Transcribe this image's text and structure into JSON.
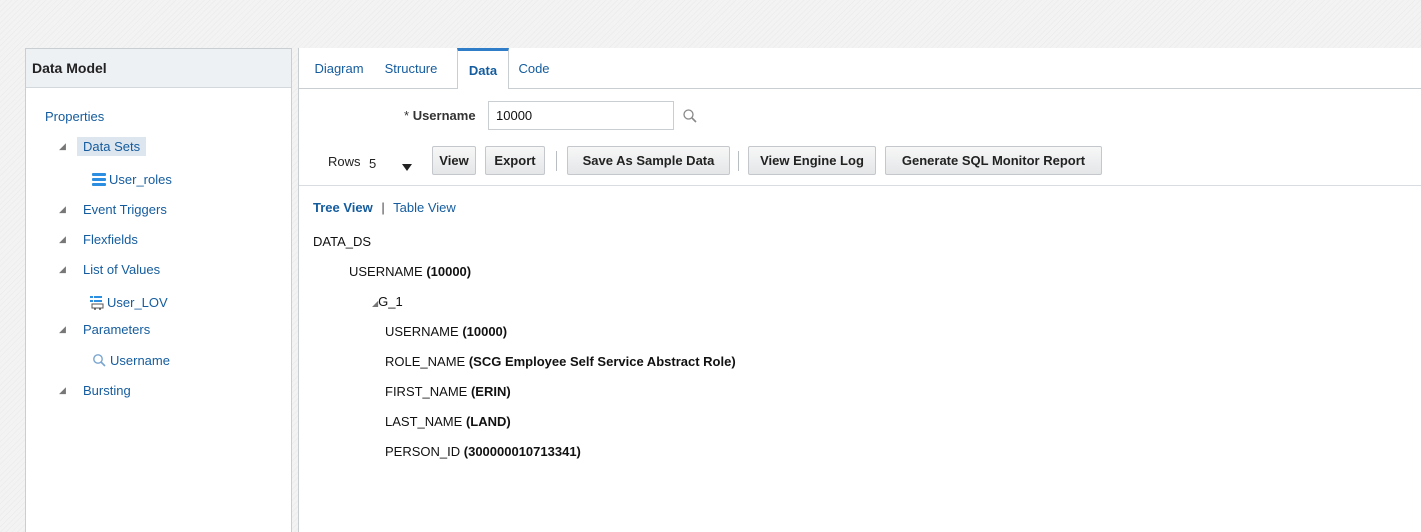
{
  "left_panel": {
    "title": "Data Model",
    "properties_label": "Properties",
    "items": [
      {
        "label": "Data Sets",
        "children": [
          {
            "label": "User_roles",
            "icon": "dataset-icon"
          }
        ]
      },
      {
        "label": "Event Triggers",
        "children": []
      },
      {
        "label": "Flexfields",
        "children": []
      },
      {
        "label": "List of Values",
        "children": [
          {
            "label": "User_LOV",
            "icon": "lov-icon"
          }
        ]
      },
      {
        "label": "Parameters",
        "children": [
          {
            "label": "Username",
            "icon": "search-icon"
          }
        ]
      },
      {
        "label": "Bursting",
        "children": []
      }
    ]
  },
  "tabs": [
    "Diagram",
    "Structure",
    "Data",
    "Code"
  ],
  "active_tab": "Data",
  "param": {
    "label": "Username",
    "required_marker": "*",
    "value": "10000"
  },
  "toolbar": {
    "rows_label": "Rows",
    "rows_value": "5",
    "view": "View",
    "export": "Export",
    "save_sample": "Save As Sample Data",
    "view_engine_log": "View Engine Log",
    "sql_monitor": "Generate SQL Monitor Report"
  },
  "view_switch": {
    "tree": "Tree View",
    "separator": "|",
    "table": "Table View"
  },
  "tree": {
    "root": "DATA_DS",
    "top_field": {
      "name": "USERNAME",
      "value": "(10000)"
    },
    "group": "G_1",
    "fields": [
      {
        "name": "USERNAME",
        "value": "(10000)"
      },
      {
        "name": "ROLE_NAME",
        "value": "(SCG Employee Self Service Abstract Role)"
      },
      {
        "name": "FIRST_NAME",
        "value": "(ERIN)"
      },
      {
        "name": "LAST_NAME",
        "value": "(LAND)"
      },
      {
        "name": "PERSON_ID",
        "value": "(300000010713341)"
      }
    ]
  },
  "colors": {
    "link": "#145c9e",
    "tab_accent": "#2f7dc8",
    "dataset_icon": "#2c8ee0"
  }
}
